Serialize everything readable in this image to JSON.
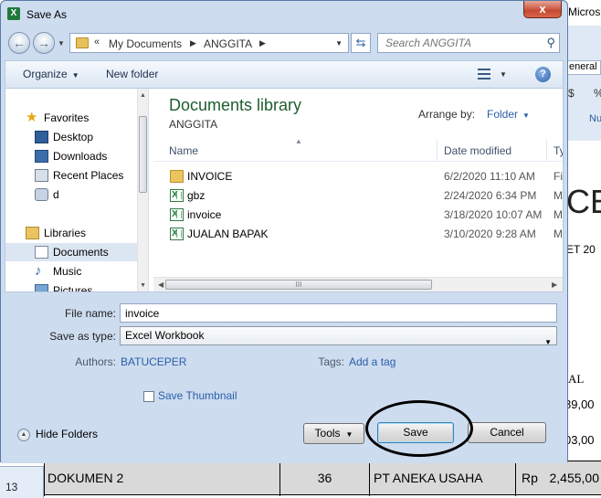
{
  "background": {
    "excel_title": "Micros",
    "number_format": "eneral",
    "ribbon_pct": "$",
    "ribbon_pct2": "%",
    "ribbon_group": "Nu",
    "big_letter": "CE",
    "sheet_text": "ET 20",
    "col_header_al": "AL",
    "val_89": "89,00",
    "val_03": "03,00",
    "row_number": "13",
    "row_cells": [
      "DOKUMEN 2",
      "36",
      "PT ANEKA USAHA",
      "Rp",
      "2,455,00"
    ]
  },
  "dialog": {
    "app_icon": "X",
    "title": "Save As",
    "close": "x"
  },
  "nav": {
    "back": "←",
    "forward": "→",
    "breadcrumb_prefix": "«",
    "crumbs": [
      "My Documents",
      "ANGGITA"
    ],
    "search_placeholder": "Search ANGGITA"
  },
  "toolbar": {
    "organize": "Organize",
    "new_folder": "New folder",
    "help": "?"
  },
  "navpane": {
    "items": [
      {
        "label": "Favorites",
        "icon": "star-icon"
      },
      {
        "label": "Desktop",
        "icon": "desktop-icon"
      },
      {
        "label": "Downloads",
        "icon": "downloads-icon"
      },
      {
        "label": "Recent Places",
        "icon": "recent-places-icon"
      },
      {
        "label": "d",
        "icon": "drive-icon"
      },
      {
        "label": "Libraries",
        "icon": "libraries-icon"
      },
      {
        "label": "Documents",
        "icon": "documents-icon"
      },
      {
        "label": "Music",
        "icon": "music-icon"
      },
      {
        "label": "Pictures",
        "icon": "pictures-icon"
      }
    ]
  },
  "library": {
    "title": "Documents library",
    "subtitle": "ANGGITA",
    "arrange_label": "Arrange by:",
    "arrange_value": "Folder"
  },
  "columns": {
    "name": "Name",
    "date": "Date modified",
    "type": "Ty"
  },
  "files": [
    {
      "name": "INVOICE",
      "date": "6/2/2020 11:10 AM",
      "type": "Fil",
      "icon": "folder-icon"
    },
    {
      "name": "gbz",
      "date": "2/24/2020 6:34 PM",
      "type": "Mi",
      "icon": "excel-file-icon"
    },
    {
      "name": "invoice",
      "date": "3/18/2020 10:07 AM",
      "type": "Mi",
      "icon": "excel-file-icon"
    },
    {
      "name": "JUALAN BAPAK",
      "date": "3/10/2020 9:28 AM",
      "type": "Mi",
      "icon": "excel-file-icon"
    }
  ],
  "scroll_grip": "III",
  "form": {
    "filename_label": "File name:",
    "filename_value": "invoice",
    "savetype_label": "Save as type:",
    "savetype_value": "Excel Workbook",
    "authors_label": "Authors:",
    "authors_value": "BATUCEPER",
    "tags_label": "Tags:",
    "tags_value": "Add a tag",
    "thumbnail_label": "Save Thumbnail",
    "hide_folders": "Hide Folders",
    "tools": "Tools",
    "save": "Save",
    "cancel": "Cancel"
  }
}
